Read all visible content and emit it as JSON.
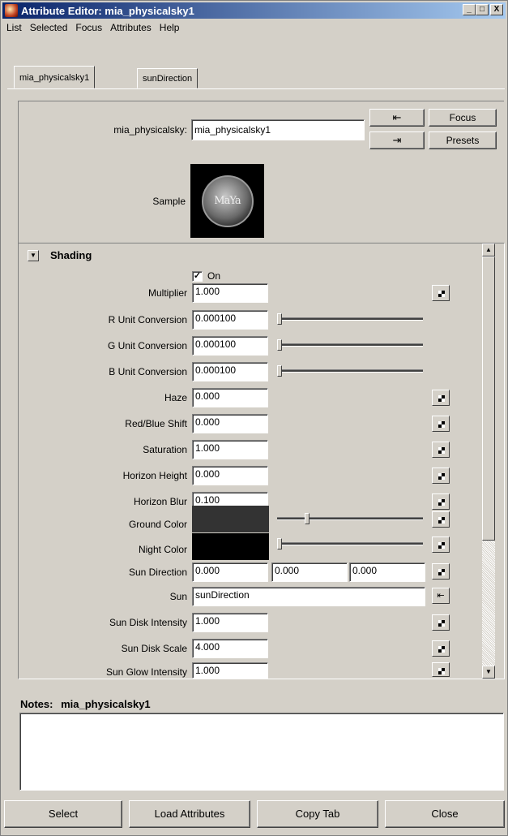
{
  "window": {
    "title": "Attribute Editor: mia_physicalsky1",
    "minimize": "_",
    "maximize": "□",
    "close": "X"
  },
  "menu": [
    "List",
    "Selected",
    "Focus",
    "Attributes",
    "Help"
  ],
  "tabs": [
    {
      "label": "mia_physicalsky1",
      "active": true
    },
    {
      "label": "sunDirection",
      "active": false
    }
  ],
  "node": {
    "label": "mia_physicalsky:",
    "value": "mia_physicalsky1",
    "focus_button": "Focus",
    "presets_button": "Presets",
    "sample_label": "Sample",
    "sample_logo": "MaYa"
  },
  "section": {
    "title": "Shading",
    "on_label": "On",
    "on_checked": true
  },
  "attributes": {
    "multiplier": {
      "label": "Multiplier",
      "value": "1.000"
    },
    "r_unit": {
      "label": "R Unit Conversion",
      "value": "0.000100",
      "slider": 0.0
    },
    "g_unit": {
      "label": "G Unit Conversion",
      "value": "0.000100",
      "slider": 0.0
    },
    "b_unit": {
      "label": "B Unit Conversion",
      "value": "0.000100",
      "slider": 0.0
    },
    "haze": {
      "label": "Haze",
      "value": "0.000"
    },
    "redblue": {
      "label": "Red/Blue Shift",
      "value": "0.000"
    },
    "saturation": {
      "label": "Saturation",
      "value": "1.000"
    },
    "horizon_height": {
      "label": "Horizon Height",
      "value": "0.000"
    },
    "horizon_blur": {
      "label": "Horizon Blur",
      "value": "0.100"
    },
    "ground_color": {
      "label": "Ground Color",
      "color": "#333333",
      "slider": 0.2
    },
    "night_color": {
      "label": "Night Color",
      "color": "#000000",
      "slider": 0.0
    },
    "sun_direction": {
      "label": "Sun Direction",
      "x": "0.000",
      "y": "0.000",
      "z": "0.000"
    },
    "sun": {
      "label": "Sun",
      "value": "sunDirection"
    },
    "sun_disk_intensity": {
      "label": "Sun Disk Intensity",
      "value": "1.000"
    },
    "sun_disk_scale": {
      "label": "Sun Disk Scale",
      "value": "4.000"
    },
    "sun_glow_intensity": {
      "label": "Sun Glow Intensity",
      "value": "1.000"
    }
  },
  "notes": {
    "label": "Notes:",
    "node": "mia_physicalsky1",
    "text": ""
  },
  "buttons": {
    "select": "Select",
    "load": "Load Attributes",
    "copy": "Copy Tab",
    "close": "Close"
  },
  "icons": {
    "app": "maya-app-icon",
    "map": "checker-map-icon",
    "input_connection": "input-connection-icon",
    "output_connection": "output-connection-icon"
  }
}
